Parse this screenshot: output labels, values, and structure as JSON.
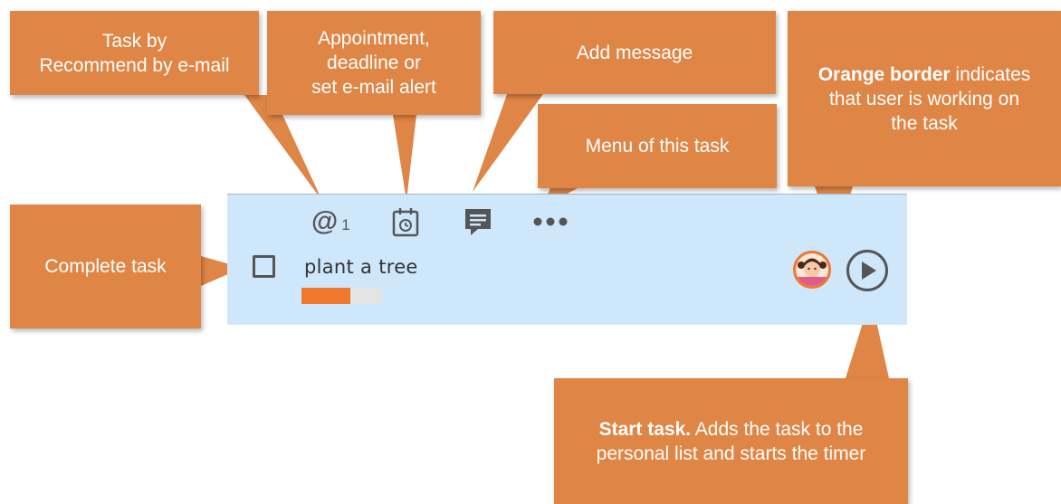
{
  "callouts": {
    "task_by": [
      "Task by",
      "Recommend by e-mail"
    ],
    "appointment": [
      "Appointment,",
      "deadline or",
      "set e-mail alert"
    ],
    "add_message": [
      "Add message"
    ],
    "menu": [
      "Menu of this task"
    ],
    "orange_border": {
      "bold": "Orange border",
      "rest_1": " indicates",
      "line2": "that user is working on",
      "line3": "the task"
    },
    "complete": [
      "Complete task"
    ],
    "start_task": {
      "bold": "Start task.",
      "rest_1": " Adds the task to the",
      "line2": "personal list and starts the timer"
    }
  },
  "task": {
    "name": "plant a tree",
    "mention_symbol": "@",
    "mention_count": "1",
    "progress_fraction": 0.6
  },
  "icons": [
    "at-icon",
    "calendar-icon",
    "message-icon",
    "more-icon",
    "avatar-icon",
    "play-icon"
  ],
  "colors": {
    "callout": "#df8545",
    "row_background": "#cfe7fb",
    "progress": "#f0782d",
    "working_border": "#f0782d"
  }
}
